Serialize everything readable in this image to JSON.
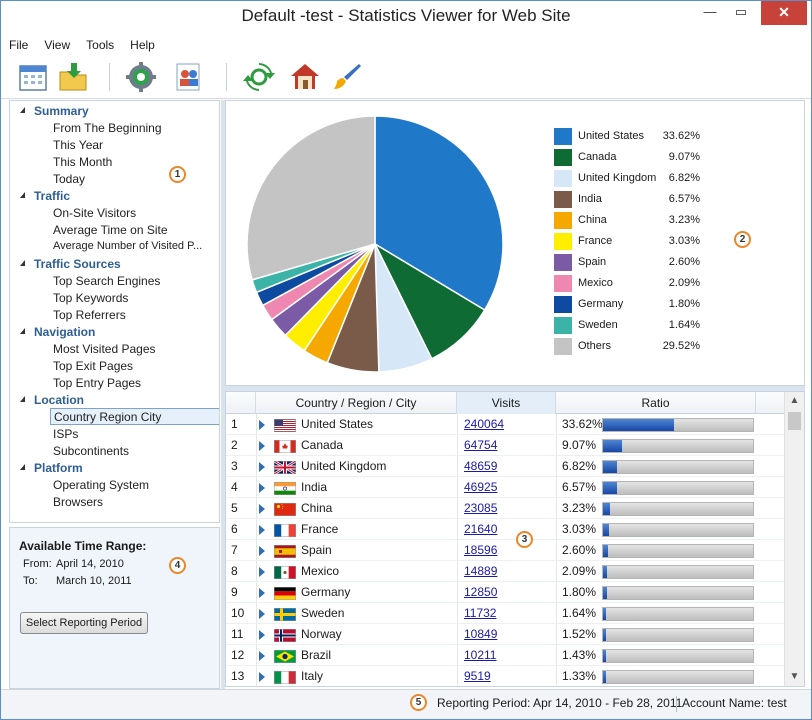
{
  "window": {
    "title": "Default -test - Statistics Viewer for Web Site",
    "minimize_glyph": "—",
    "maximize_glyph": "▭",
    "close_glyph": "✕"
  },
  "menu": [
    "File",
    "View",
    "Tools",
    "Help"
  ],
  "toolbar": {
    "icons": [
      "calendar-icon",
      "import-icon",
      "settings-icon",
      "users-icon",
      "refresh-icon",
      "home-icon",
      "brush-icon"
    ]
  },
  "nav": {
    "groups": [
      {
        "label": "Summary",
        "items": [
          "From The Beginning",
          "This Year",
          "This Month",
          "Today"
        ]
      },
      {
        "label": "Traffic",
        "items": [
          "On-Site Visitors",
          "Average Time on Site",
          "Average Number of Visited P..."
        ]
      },
      {
        "label": "Traffic Sources",
        "items": [
          "Top Search Engines",
          "Top Keywords",
          "Top Referrers"
        ]
      },
      {
        "label": "Navigation",
        "items": [
          "Most Visited Pages",
          "Top Exit Pages",
          "Top Entry Pages"
        ]
      },
      {
        "label": "Location",
        "items": [
          "Country Region City",
          "ISPs",
          "Subcontinents"
        ]
      },
      {
        "label": "Platform",
        "items": [
          "Operating System",
          "Browsers"
        ]
      }
    ],
    "selected": "Country Region City"
  },
  "time_range": {
    "heading": "Available Time Range:",
    "from_label": "From:",
    "from_value": "April 14, 2010",
    "to_label": "To:",
    "to_value": "March 10, 2011",
    "button": "Select Reporting Period"
  },
  "markers": [
    "1",
    "2",
    "3",
    "4",
    "5"
  ],
  "chart_data": {
    "type": "pie",
    "slices": [
      {
        "name": "United States",
        "value": 33.62,
        "label": "33.62%",
        "color": "#1f78c8"
      },
      {
        "name": "Canada",
        "value": 9.07,
        "label": "9.07%",
        "color": "#0e6b33"
      },
      {
        "name": "United Kingdom",
        "value": 6.82,
        "label": "6.82%",
        "color": "#d6e7f7"
      },
      {
        "name": "India",
        "value": 6.57,
        "label": "6.57%",
        "color": "#7a5a48"
      },
      {
        "name": "China",
        "value": 3.23,
        "label": "3.23%",
        "color": "#f5a800"
      },
      {
        "name": "France",
        "value": 3.03,
        "label": "3.03%",
        "color": "#ffee00"
      },
      {
        "name": "Spain",
        "value": 2.6,
        "label": "2.60%",
        "color": "#7b5aa6"
      },
      {
        "name": "Mexico",
        "value": 2.09,
        "label": "2.09%",
        "color": "#ee88b0"
      },
      {
        "name": "Germany",
        "value": 1.8,
        "label": "1.80%",
        "color": "#0d4ba0"
      },
      {
        "name": "Sweden",
        "value": 1.64,
        "label": "1.64%",
        "color": "#3bb3a6"
      },
      {
        "name": "Others",
        "value": 29.52,
        "label": "29.52%",
        "color": "#c4c4c4"
      }
    ],
    "legend": "right"
  },
  "table": {
    "headers": [
      "Country / Region / City",
      "Visits",
      "Ratio"
    ],
    "rows": [
      {
        "n": "1",
        "name": "United States",
        "visits": "240064",
        "ratio": "33.62%",
        "frac": 0.3362,
        "flag": "us"
      },
      {
        "n": "2",
        "name": "Canada",
        "visits": "64754",
        "ratio": "9.07%",
        "frac": 0.0907,
        "flag": "ca"
      },
      {
        "n": "3",
        "name": "United Kingdom",
        "visits": "48659",
        "ratio": "6.82%",
        "frac": 0.0682,
        "flag": "gb"
      },
      {
        "n": "4",
        "name": "India",
        "visits": "46925",
        "ratio": "6.57%",
        "frac": 0.0657,
        "flag": "in"
      },
      {
        "n": "5",
        "name": "China",
        "visits": "23085",
        "ratio": "3.23%",
        "frac": 0.0323,
        "flag": "cn"
      },
      {
        "n": "6",
        "name": "France",
        "visits": "21640",
        "ratio": "3.03%",
        "frac": 0.0303,
        "flag": "fr"
      },
      {
        "n": "7",
        "name": "Spain",
        "visits": "18596",
        "ratio": "2.60%",
        "frac": 0.026,
        "flag": "es"
      },
      {
        "n": "8",
        "name": "Mexico",
        "visits": "14889",
        "ratio": "2.09%",
        "frac": 0.0209,
        "flag": "mx"
      },
      {
        "n": "9",
        "name": "Germany",
        "visits": "12850",
        "ratio": "1.80%",
        "frac": 0.018,
        "flag": "de"
      },
      {
        "n": "10",
        "name": "Sweden",
        "visits": "11732",
        "ratio": "1.64%",
        "frac": 0.0164,
        "flag": "se"
      },
      {
        "n": "11",
        "name": "Norway",
        "visits": "10849",
        "ratio": "1.52%",
        "frac": 0.0152,
        "flag": "no"
      },
      {
        "n": "12",
        "name": "Brazil",
        "visits": "10211",
        "ratio": "1.43%",
        "frac": 0.0143,
        "flag": "br"
      },
      {
        "n": "13",
        "name": "Italy",
        "visits": "9519",
        "ratio": "1.33%",
        "frac": 0.0133,
        "flag": "it"
      }
    ]
  },
  "status": {
    "period": "Reporting Period: Apr 14, 2010 - Feb 28, 2011",
    "account": "Account Name: test"
  }
}
